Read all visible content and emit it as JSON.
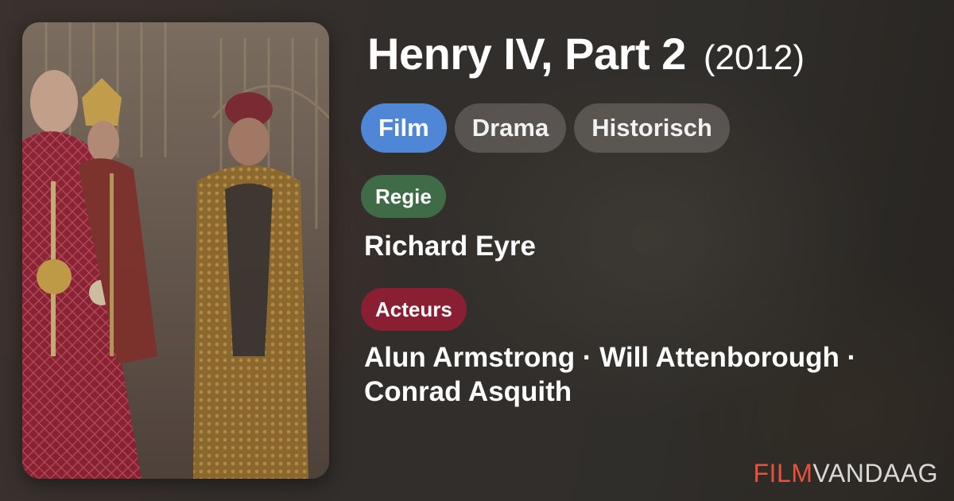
{
  "movie": {
    "title": "Henry IV, Part 2",
    "year": "(2012)"
  },
  "genres": [
    {
      "label": "Film",
      "primary": true
    },
    {
      "label": "Drama",
      "primary": false
    },
    {
      "label": "Historisch",
      "primary": false
    }
  ],
  "director": {
    "label": "Regie",
    "name": "Richard Eyre"
  },
  "cast": {
    "label": "Acteurs",
    "line1": "Alun Armstrong · Will Attenborough ·",
    "line2": "Conrad Asquith"
  },
  "brand": {
    "part1": "FILM",
    "part2": "VANDAAG"
  },
  "colors": {
    "film_chip": "#4f86d6",
    "regie_label": "#3f6b47",
    "acteurs_label": "#8a1f33",
    "brand_accent": "#e8503f"
  }
}
